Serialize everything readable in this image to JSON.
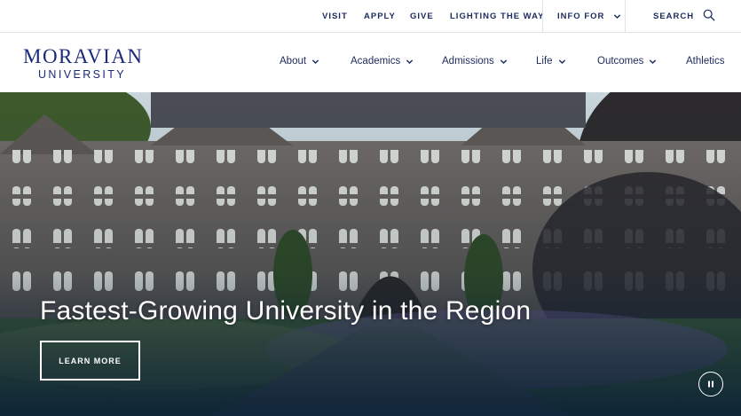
{
  "utility_nav": {
    "visit": "VISIT",
    "apply": "APPLY",
    "give": "GIVE",
    "lighting": "LIGHTING THE WAY",
    "info_for": "INFO FOR",
    "search": "SEARCH"
  },
  "logo": {
    "line1": "MORAVIAN",
    "line2": "UNIVERSITY"
  },
  "main_nav": {
    "items": [
      {
        "label": "About",
        "has_dropdown": true
      },
      {
        "label": "Academics",
        "has_dropdown": true
      },
      {
        "label": "Admissions",
        "has_dropdown": true
      },
      {
        "label": "Life",
        "has_dropdown": true
      },
      {
        "label": "Outcomes",
        "has_dropdown": true
      },
      {
        "label": "Athletics",
        "has_dropdown": false
      }
    ]
  },
  "hero": {
    "title": "Fastest-Growing University in the Region",
    "cta_label": "LEARN MORE",
    "pause_icon": "pause-icon"
  },
  "colors": {
    "brand_navy": "#1b2a5c",
    "logo_blue": "#1b2a7a",
    "white": "#ffffff"
  }
}
